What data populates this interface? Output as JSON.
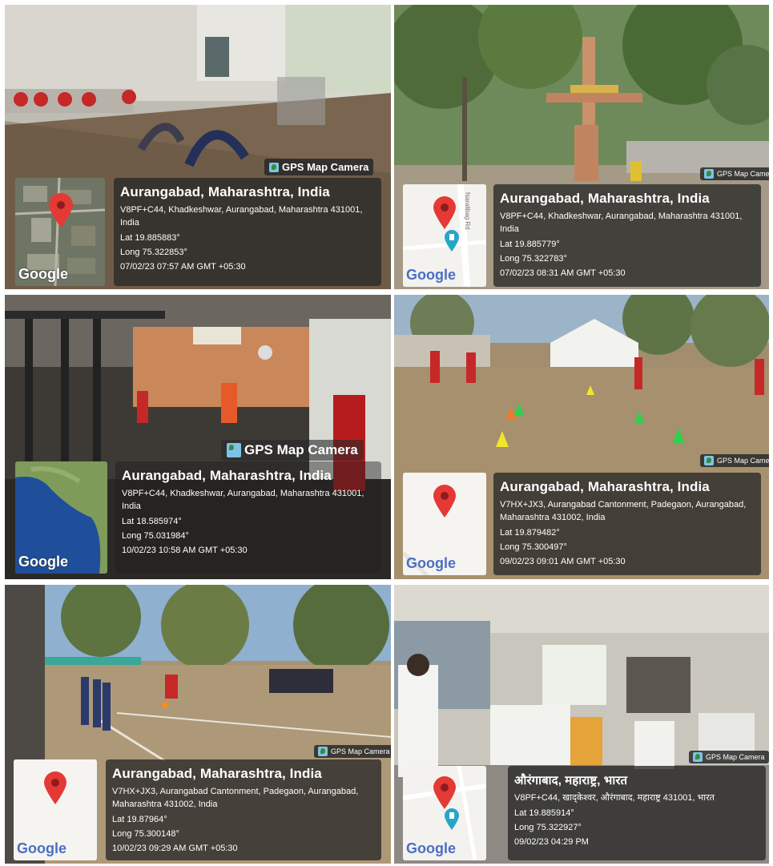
{
  "badge_label": "GPS Map Camera",
  "map_logo": "Google",
  "tiles": [
    {
      "title": "Aurangabad, Maharashtra, India",
      "address": "V8PF+C44, Khadkeshwar, Aurangabad, Maharashtra 431001, India",
      "lat": "Lat 19.885883°",
      "long": "Long 75.322853°",
      "datetime": "07/02/23 07:57 AM GMT +05:30"
    },
    {
      "title": "Aurangabad, Maharashtra, India",
      "address": "V8PF+C44, Khadkeshwar, Aurangabad, Maharashtra 431001, India",
      "lat": "Lat 19.885779°",
      "long": "Long 75.322783°",
      "datetime": "07/02/23 08:31 AM GMT +05:30",
      "map_street": "Naralibag Rd"
    },
    {
      "title": "Aurangabad, Maharashtra, India",
      "address": "V8PF+C44, Khadkeshwar, Aurangabad, Maharashtra 431001, India",
      "lat": "Lat 18.585974°",
      "long": "Long 75.031984°",
      "datetime": "10/02/23 10:58 AM GMT +05:30"
    },
    {
      "title": "Aurangabad, Maharashtra, India",
      "address": "V7HX+JX3, Aurangabad Cantonment, Padegaon, Aurangabad, Maharashtra 431002, India",
      "lat": "Lat 19.879482°",
      "long": "Long 75.300497°",
      "datetime": "09/02/23 09:01 AM GMT +05:30"
    },
    {
      "title": "Aurangabad, Maharashtra, India",
      "address": "V7HX+JX3, Aurangabad Cantonment, Padegaon, Aurangabad, Maharashtra 431002, India",
      "lat": "Lat 19.87964°",
      "long": "Long 75.300148°",
      "datetime": "10/02/23 09:29 AM GMT +05:30"
    },
    {
      "title": "औरंगाबाद, महाराष्ट्र, भारत",
      "address": "V8PF+C44, खाद्केश्वर, औरंगाबाद, महाराष्ट्र 431001, भारत",
      "lat": "Lat 19.885914°",
      "long": "Long 75.322927°",
      "datetime": "09/02/23 04:29 PM"
    }
  ]
}
